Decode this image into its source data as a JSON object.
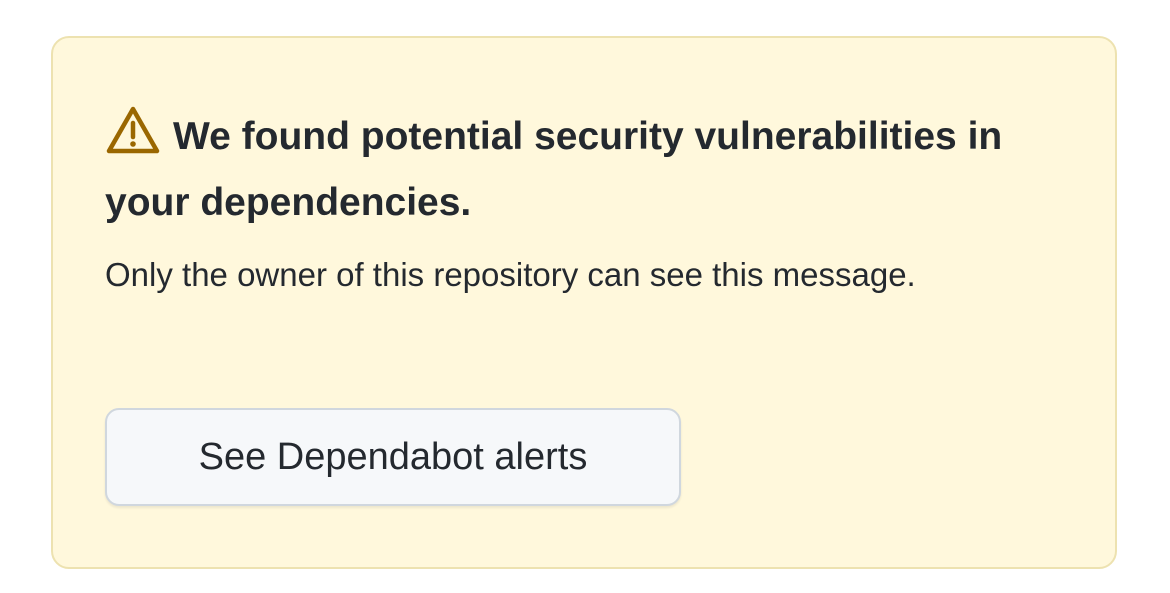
{
  "alert": {
    "icon": "alert-triangle-icon",
    "icon_color": "#9a6700",
    "background_color": "#fff8dc",
    "border_color": "#ede2b0",
    "title": "We found potential security vulnerabilities in your dependencies.",
    "description": "Only the owner of this repository can see this message.",
    "button_label": "See Dependabot alerts"
  }
}
